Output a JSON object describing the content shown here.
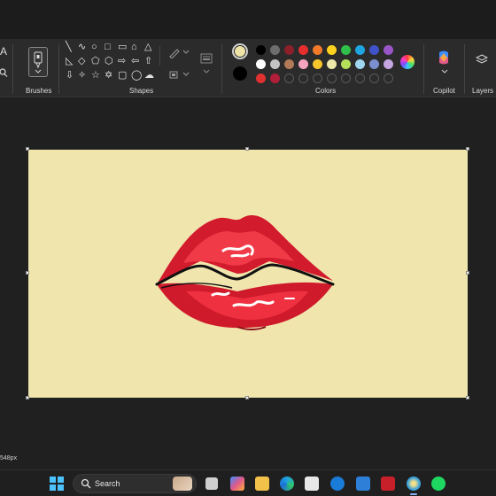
{
  "ribbon": {
    "groups": {
      "brushes": "Brushes",
      "shapes": "Shapes",
      "colors": "Colors",
      "copilot": "Copilot",
      "layers": "Layers"
    },
    "text_tool_glyph": "A",
    "primary_color": "#efe3a8",
    "secondary_color": "#000000",
    "palette": {
      "row1": [
        "#000000",
        "#6e6e6e",
        "#8b1f2a",
        "#e62e2e",
        "#f07a2a",
        "#ffd21e",
        "#2fbf4a",
        "#1fa6e0",
        "#3f52c8",
        "#9a55c8"
      ],
      "row2": [
        "#ffffff",
        "#c3c3c3",
        "#b37a57",
        "#f4a3c0",
        "#f8c52a",
        "#eee8aa",
        "#b6e05a",
        "#9fd6f0",
        "#7b8fd0",
        "#c5a6e0"
      ],
      "row3": [
        "#e03030",
        "#b01e3a"
      ]
    }
  },
  "status": {
    "size_text": "548px"
  },
  "taskbar": {
    "search_placeholder": "Search",
    "apps": [
      "start",
      "search",
      "task-view",
      "copilot",
      "file-explorer",
      "edge",
      "store",
      "dell",
      "mail",
      "mcafee",
      "paint",
      "spotify"
    ]
  }
}
